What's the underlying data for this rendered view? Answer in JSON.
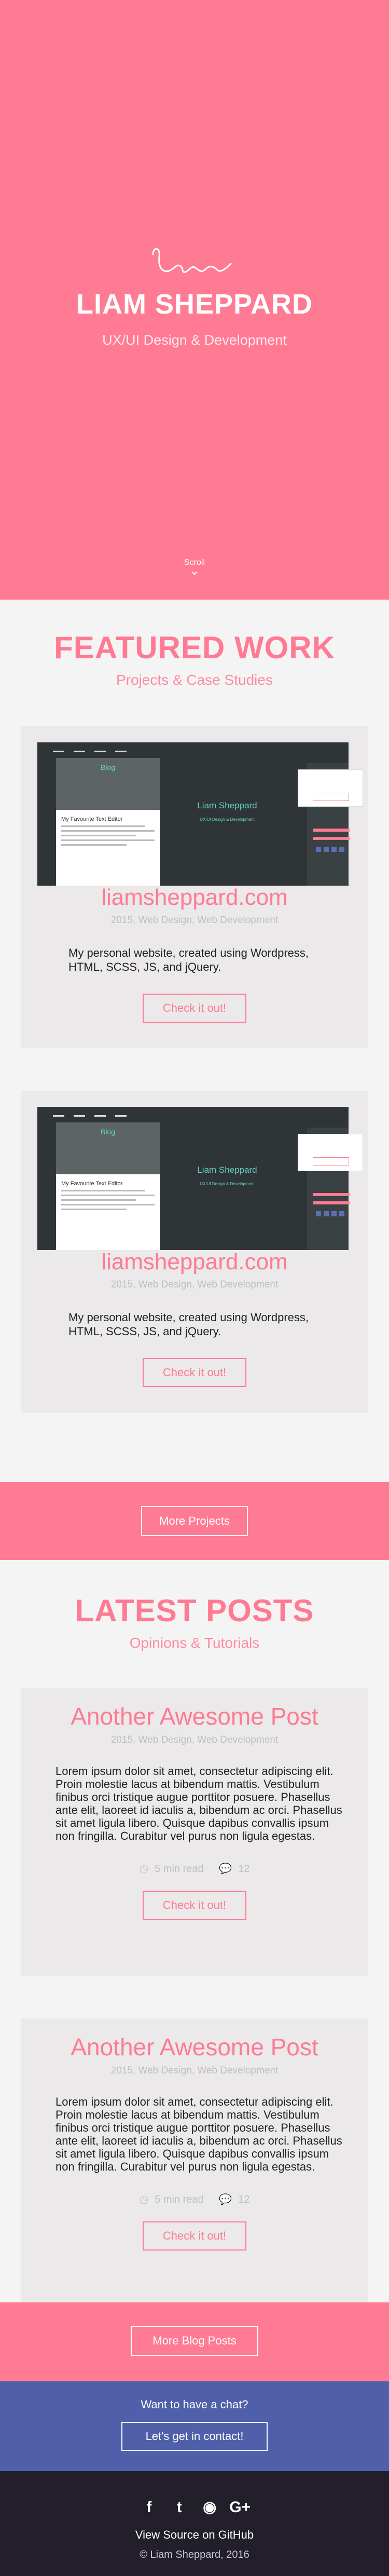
{
  "hero": {
    "name": "LIAM SHEPPARD",
    "tagline": "UX/UI Design & Development",
    "scroll_label": "Scroll"
  },
  "featured": {
    "title": "FEATURED WORK",
    "subtitle": "Projects & Case Studies",
    "projects": [
      {
        "name": "liamsheppard.com",
        "meta": "2015, Web Design, Web Development",
        "description": "My personal website, created using Wordpress, HTML, SCSS, JS, and jQuery.",
        "button": "Check it out!",
        "preview": {
          "blog_label": "Blog",
          "doc_title": "My Favourite Text Editor",
          "center_name": "Liam Sheppard",
          "center_sub": "UX/UI Design & Development"
        }
      },
      {
        "name": "liamsheppard.com",
        "meta": "2015, Web Design, Web Development",
        "description": "My personal website, created using Wordpress, HTML, SCSS, JS, and jQuery.",
        "button": "Check it out!",
        "preview": {
          "blog_label": "Blog",
          "doc_title": "My Favourite Text Editor",
          "center_name": "Liam Sheppard",
          "center_sub": "UX/UI Design & Development"
        }
      }
    ],
    "more_button": "More Projects"
  },
  "posts": {
    "title": "LATEST POSTS",
    "subtitle": "Opinions & Tutorials",
    "items": [
      {
        "title": "Another Awesome Post",
        "meta": "2015, Web Design, Web Development",
        "body": "Lorem ipsum dolor sit amet, consectetur adipiscing elit. Proin molestie lacus at bibendum mattis. Vestibulum finibus orci tristique augue porttitor posuere. Phasellus ante elit, laoreet id iaculis a, bibendum ac orci. Phasellus sit amet ligula libero. Quisque dapibus convallis ipsum non fringilla. Curabitur vel purus non ligula egestas.",
        "read_time": "5 min read",
        "comments": "12",
        "button": "Check it out!"
      },
      {
        "title": "Another Awesome Post",
        "meta": "2015, Web Design, Web Development",
        "body": "Lorem ipsum dolor sit amet, consectetur adipiscing elit. Proin molestie lacus at bibendum mattis. Vestibulum finibus orci tristique augue porttitor posuere. Phasellus ante elit, laoreet id iaculis a, bibendum ac orci. Phasellus sit amet ligula libero. Quisque dapibus convallis ipsum non fringilla. Curabitur vel purus non ligula egestas.",
        "read_time": "5 min read",
        "comments": "12",
        "button": "Check it out!"
      }
    ],
    "more_button": "More Blog Posts"
  },
  "contact": {
    "prompt": "Want to have a chat?",
    "button": "Let's get in contact!"
  },
  "footer": {
    "social": [
      {
        "icon": "facebook-icon",
        "glyph": "f"
      },
      {
        "icon": "twitter-icon",
        "glyph": "t"
      },
      {
        "icon": "github-icon",
        "glyph": "◉"
      },
      {
        "icon": "google-plus-icon",
        "glyph": "G+"
      }
    ],
    "source_link": "View Source on GitHub",
    "copyright": "© Liam Sheppard, 2016"
  },
  "colors": {
    "brand_pink": "#ff7a93",
    "contact_blue": "#4f5faa",
    "footer_dark": "#221f2b",
    "card_bg": "#ebe9e9",
    "accent_teal": "#5fd1c0"
  }
}
